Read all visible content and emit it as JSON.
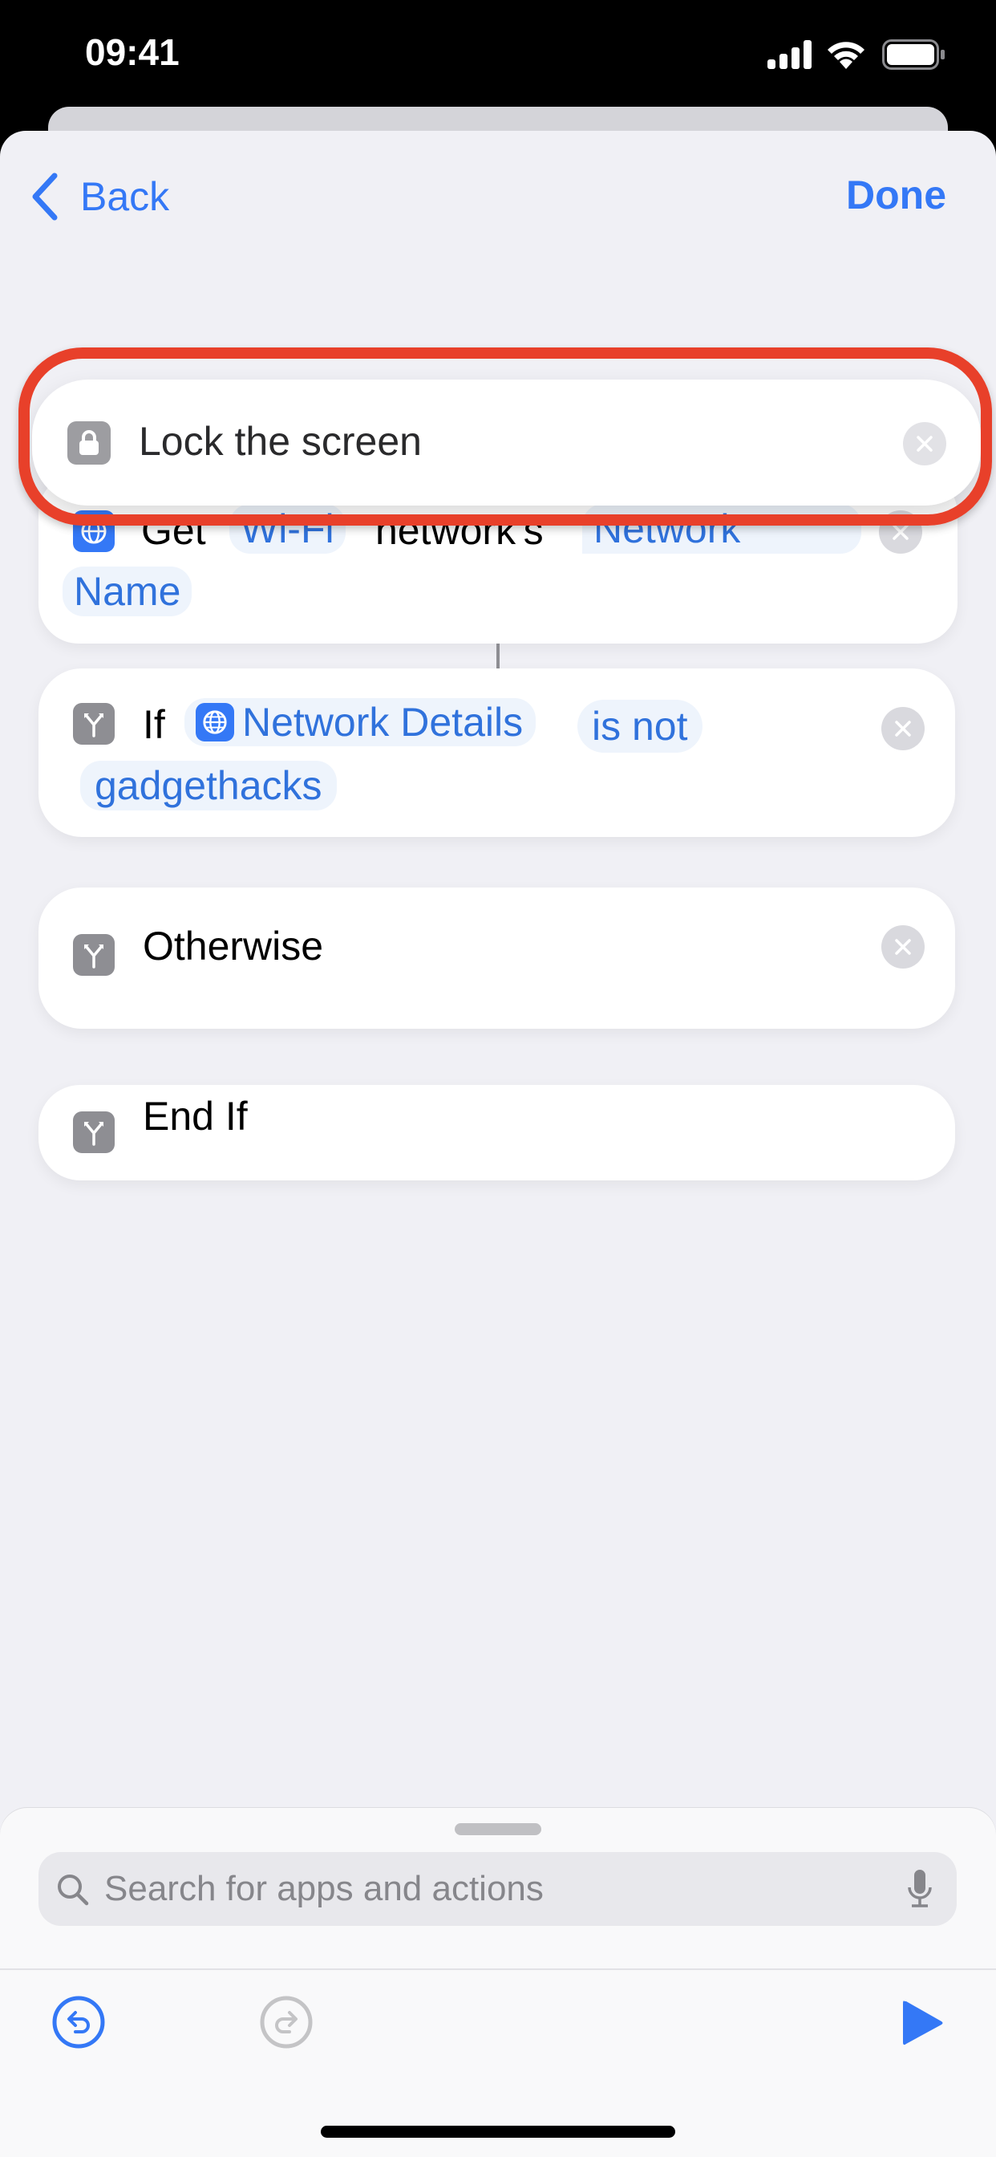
{
  "status_bar": {
    "time": "09:41",
    "signal_icon": "cellular-signal-icon",
    "wifi_icon": "wifi-icon",
    "battery_icon": "battery-icon"
  },
  "nav": {
    "back_label": "Back",
    "done_label": "Done"
  },
  "colors": {
    "accent": "#3478F6",
    "highlight_outline": "#E8402A",
    "action_icon_gray": "#8E8E93",
    "pill_bg": "#EEF4FC"
  },
  "dragged_action": {
    "icon": "lock-icon",
    "label": "Lock the screen",
    "highlighted": true
  },
  "actions": [
    {
      "type": "get",
      "icon": "globe-icon",
      "tokens": [
        {
          "kind": "text",
          "value": "Get"
        },
        {
          "kind": "pill",
          "value": "Wi-Fi"
        },
        {
          "kind": "text",
          "value": "network's"
        },
        {
          "kind": "pill",
          "value": "Network Name"
        }
      ],
      "text_get": "Get",
      "pill_wifi": "Wi-Fi",
      "text_networks": "network's",
      "pill_network": "Network",
      "pill_name": "Name"
    },
    {
      "type": "if",
      "icon": "branch-icon",
      "keyword": "If",
      "variable": {
        "icon": "globe-icon",
        "label": "Network Details"
      },
      "condition": "is not",
      "value": "gadgethacks"
    },
    {
      "type": "otherwise",
      "icon": "branch-icon",
      "label": "Otherwise"
    },
    {
      "type": "end-if",
      "icon": "branch-icon",
      "label": "End If"
    }
  ],
  "bottom_sheet": {
    "search": {
      "placeholder": "Search for apps and actions",
      "value": ""
    },
    "mic_icon": "microphone-icon",
    "toolbar": {
      "undo": "undo-icon",
      "redo": "redo-icon",
      "run": "play-icon",
      "redo_enabled": false
    }
  }
}
